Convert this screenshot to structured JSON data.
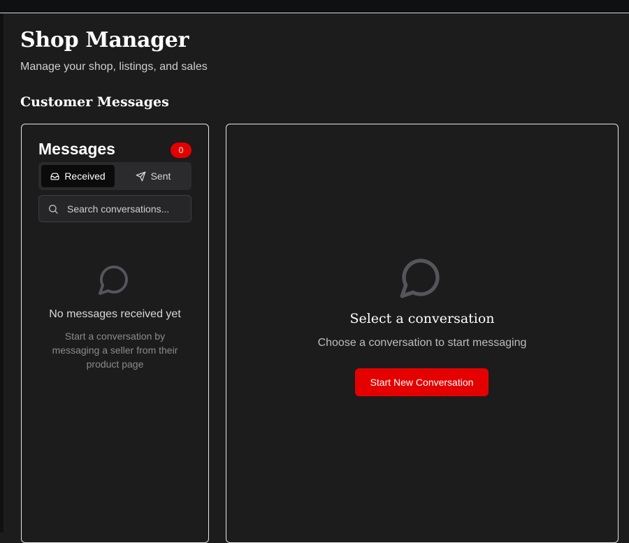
{
  "header": {
    "title": "Shop Manager",
    "subtitle": "Manage your shop, listings, and sales"
  },
  "section": {
    "title": "Customer Messages"
  },
  "messages_panel": {
    "title": "Messages",
    "unread_count": "0",
    "tabs": [
      {
        "label": "Received",
        "icon": "inbox-icon",
        "active": true
      },
      {
        "label": "Sent",
        "icon": "send-icon",
        "active": false
      }
    ],
    "search": {
      "placeholder": "Search conversations..."
    },
    "empty_state": {
      "icon": "message-bubble-icon",
      "title": "No messages received yet",
      "description": "Start a conversation by messaging a seller from their product page"
    }
  },
  "conversation_panel": {
    "icon": "message-bubble-icon",
    "title": "Select a conversation",
    "description": "Choose a conversation to start messaging",
    "button_label": "Start New Conversation"
  },
  "colors": {
    "background": "#1c1c1c",
    "accent": "#e50000",
    "panel_border": "#e8e8e8"
  }
}
